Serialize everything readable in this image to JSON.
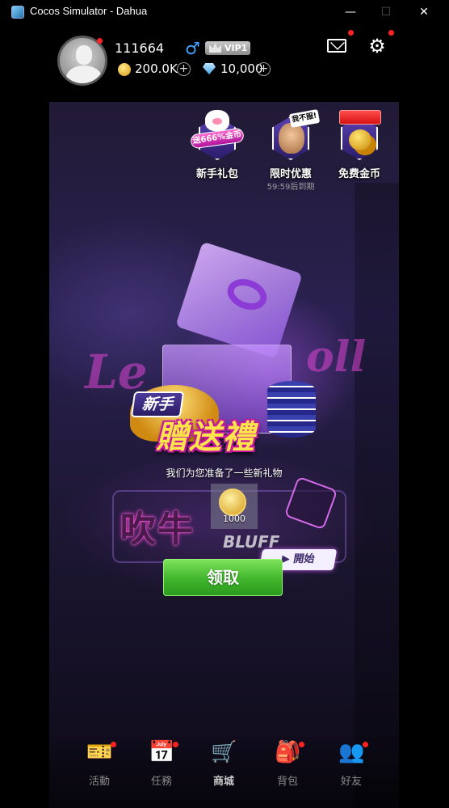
{
  "window": {
    "title": "Cocos Simulator - Dahua",
    "minimize_glyph": "—",
    "maximize_glyph": "☐",
    "close_glyph": "✕"
  },
  "profile": {
    "user_id": "111664",
    "gender_symbol": "♂",
    "vip_label": "VIP1",
    "coins": "200.0K",
    "gems": "10,000",
    "plus_glyph": "+"
  },
  "header_icons": {
    "settings_glyph": "⚙"
  },
  "top_menu": {
    "newbie_gift": {
      "label": "新手礼包",
      "promo": "送666%金币"
    },
    "limited_offer": {
      "label": "限时优惠",
      "speech": "我不服!",
      "timer": "59:59后到期"
    },
    "free_coins": {
      "label": "免费金币"
    }
  },
  "hero": {
    "newbie_tag": "新手",
    "title": "贈送禮",
    "subtitle": "我们为您准备了一些新礼物",
    "reward_amount": "1000",
    "bg_sign": "吹牛",
    "bg_sign_en": "BLUFF",
    "start_label": "▶ 開始",
    "neon_left": "Le",
    "neon_right": "oll"
  },
  "claim_button": {
    "label": "领取"
  },
  "bottom_nav": [
    {
      "label": "活動",
      "icon": "ticket-icon",
      "glyph": "🎫",
      "has_dot": true
    },
    {
      "label": "任務",
      "icon": "calendar-icon",
      "glyph": "📅",
      "has_dot": true
    },
    {
      "label": "商城",
      "icon": "shopping-cart-icon",
      "glyph": "🛒",
      "has_dot": false,
      "active": true
    },
    {
      "label": "背包",
      "icon": "backpack-icon",
      "glyph": "🎒",
      "has_dot": true
    },
    {
      "label": "好友",
      "icon": "friends-icon",
      "glyph": "👥",
      "has_dot": true
    }
  ],
  "colors": {
    "accent_green": "#3fb52c",
    "notification_red": "#ff2323",
    "gender_blue": "#3fa6ff",
    "title_gold": "#ffe44a"
  }
}
